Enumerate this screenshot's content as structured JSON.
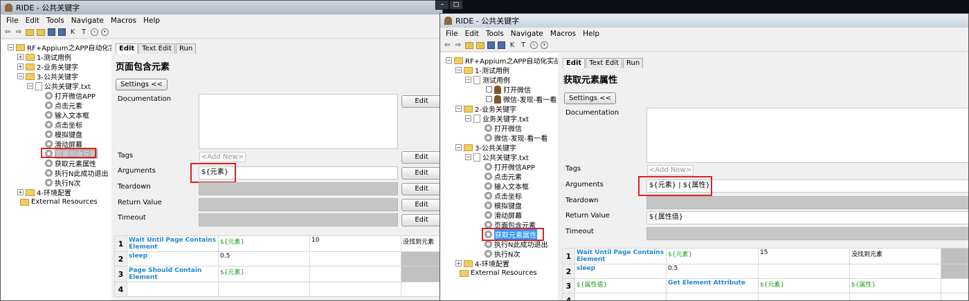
{
  "window1": {
    "title": "RIDE - 公共关键字",
    "menu": [
      "File",
      "Edit",
      "Tools",
      "Navigate",
      "Macros",
      "Help"
    ],
    "toolbar": [
      "⇦",
      "⇨",
      "K",
      "T",
      "›",
      "•"
    ],
    "tree": {
      "root": "RF+Appium之APP自动化实",
      "folder1": "1-测试用例",
      "folder2": "2-业务关键字",
      "folder3": "3-公共关键字",
      "file": "公共关键字.txt",
      "keywords": [
        "打开微信APP",
        "点击元素",
        "输入文本框",
        "点击坐标",
        "模拟键盘",
        "滑动屏幕",
        "页面包含元素",
        "获取元素属性",
        "执行N此成功退出",
        "执行N次"
      ],
      "folder4": "4-环境配置",
      "external": "External Resources"
    },
    "tabs": [
      "Edit",
      "Text Edit",
      "Run"
    ],
    "keyword_title": "页面包含元素",
    "settings_btn": "Settings <<",
    "labels": {
      "documentation": "Documentation",
      "tags": "Tags",
      "arguments": "Arguments",
      "teardown": "Teardown",
      "return_value": "Return Value",
      "timeout": "Timeout"
    },
    "edit_label": "Edit",
    "tags_placeholder": "<Add New>",
    "arguments_value": "${元素}",
    "grid": [
      {
        "n": "1",
        "c1": "Wait Until Page Contains Element",
        "c2": "${元素}",
        "c3": "10",
        "c4": "没找到元素"
      },
      {
        "n": "2",
        "c1": "sleep",
        "c2": "0.5",
        "c3": "",
        "c4": ""
      },
      {
        "n": "3",
        "c1": "Page Should Contain Element",
        "c2": "${元素}",
        "c3": "",
        "c4": ""
      },
      {
        "n": "4",
        "c1": "",
        "c2": "",
        "c3": "",
        "c4": ""
      }
    ]
  },
  "window2": {
    "title": "RIDE - 公共关键字",
    "menu": [
      "File",
      "Edit",
      "Tools",
      "Navigate",
      "Macros",
      "Help"
    ],
    "toolbar": [
      "⇦",
      "⇨",
      "K",
      "T",
      "›",
      "•"
    ],
    "tree": {
      "root": "RF+Appium之APP自动化实战",
      "folder1": "1-测试用例",
      "file1": "测试用例",
      "tests": [
        "打开微信",
        "微信-发现-看一看"
      ],
      "folder2": "2-业务关键字",
      "file2": "业务关键字.txt",
      "biz_keywords": [
        "打开微信",
        "微信-发现-看一看"
      ],
      "folder3": "3-公共关键字",
      "file3": "公共关键字.txt",
      "keywords": [
        "打开微信APP",
        "点击元素",
        "输入文本框",
        "点击坐标",
        "模拟键盘",
        "滑动屏幕",
        "页面包含元素",
        "获取元素属性",
        "执行N此成功退出",
        "执行N次"
      ],
      "folder4": "4-环境配置",
      "external": "External Resources"
    },
    "tabs": [
      "Edit",
      "Text Edit",
      "Run"
    ],
    "keyword_title": "获取元素属性",
    "settings_btn": "Settings <<",
    "labels": {
      "documentation": "Documentation",
      "tags": "Tags",
      "arguments": "Arguments",
      "teardown": "Teardown",
      "return_value": "Return Value",
      "timeout": "Timeout"
    },
    "tags_placeholder": "<Add New>",
    "arguments_value": "${元素} | ${属性}",
    "return_value": "${属性值}",
    "grid": [
      {
        "n": "1",
        "c1": "Wait Until Page Contains Element",
        "c2": "${元素}",
        "c3": "15",
        "c4": "没找到元素"
      },
      {
        "n": "2",
        "c1": "sleep",
        "c2": "0.5",
        "c3": "",
        "c4": ""
      },
      {
        "n": "3",
        "c0": "${属性值}",
        "c1": "Get Element Attribute",
        "c2": "${元素}",
        "c3": "${属性}"
      },
      {
        "n": "4",
        "c1": "",
        "c2": "",
        "c3": "",
        "c4": ""
      }
    ]
  }
}
